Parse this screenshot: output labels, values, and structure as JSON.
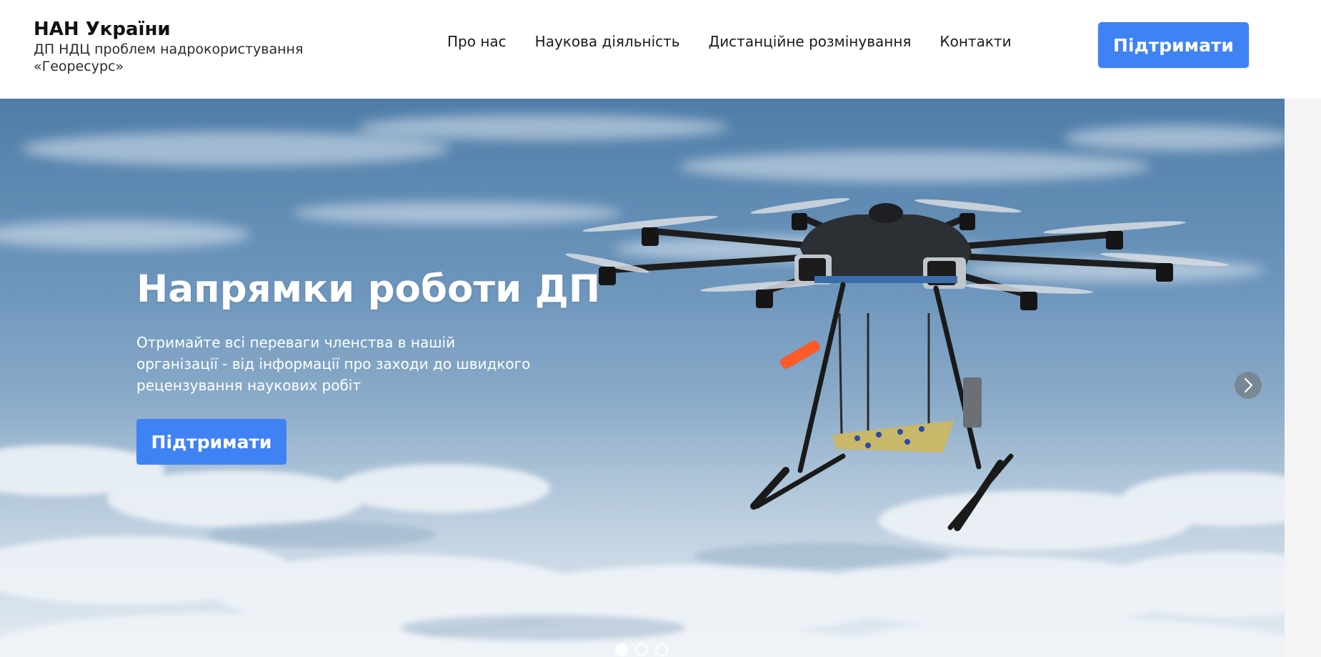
{
  "header": {
    "org_title": "НАН України",
    "org_subtitle_line1": "ДП НДЦ проблем надрокористування",
    "org_subtitle_line2": "«Георесурс»",
    "nav": [
      {
        "label": "Про нас"
      },
      {
        "label": "Наукова діяльність"
      },
      {
        "label": "Дистанційне розмінування"
      },
      {
        "label": "Контакти"
      }
    ],
    "cta_label": "Підтримати"
  },
  "hero": {
    "title": "Напрямки роботи ДП",
    "description": "Отримайте всі переваги членства в нашій організації - від інформації про заходи до швидкого рецензування наукових робіт",
    "cta_label": "Підтримати",
    "image_subject": "drone-over-clouds",
    "slides_total": 3,
    "active_slide": 1
  },
  "colors": {
    "accent": "#3f82f3",
    "header_bg": "#ffffff",
    "sky_top": "#4f7da8",
    "sky_bottom": "#c3d3e1"
  },
  "icons": {
    "next": "chevron-right-icon"
  }
}
